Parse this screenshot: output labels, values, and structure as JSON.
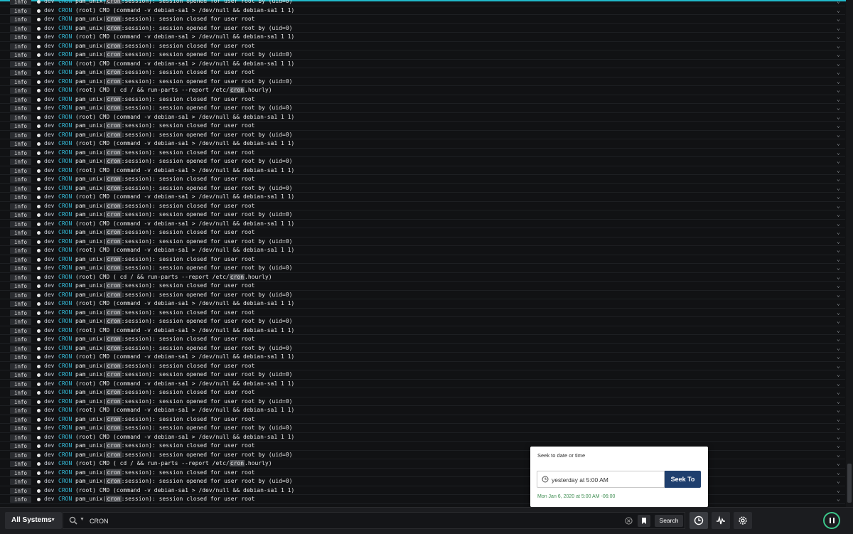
{
  "log": {
    "level": "info",
    "host": "dev",
    "program": "CRON",
    "highlight": "cron",
    "expand_icon": "chevron-down-icon",
    "rows": [
      "pam_unix(cron:session): session opened for user root by (uid=0)",
      "(root) CMD (command -v debian-sa1 > /dev/null && debian-sa1 1 1)",
      "pam_unix(cron:session): session closed for user root",
      "pam_unix(cron:session): session opened for user root by (uid=0)",
      "(root) CMD (command -v debian-sa1 > /dev/null && debian-sa1 1 1)",
      "pam_unix(cron:session): session closed for user root",
      "pam_unix(cron:session): session opened for user root by (uid=0)",
      "(root) CMD (command -v debian-sa1 > /dev/null && debian-sa1 1 1)",
      "pam_unix(cron:session): session closed for user root",
      "pam_unix(cron:session): session opened for user root by (uid=0)",
      "(root) CMD ( cd / && run-parts --report /etc/cron.hourly)",
      "pam_unix(cron:session): session closed for user root",
      "pam_unix(cron:session): session opened for user root by (uid=0)",
      "(root) CMD (command -v debian-sa1 > /dev/null && debian-sa1 1 1)",
      "pam_unix(cron:session): session closed for user root",
      "pam_unix(cron:session): session opened for user root by (uid=0)",
      "(root) CMD (command -v debian-sa1 > /dev/null && debian-sa1 1 1)",
      "pam_unix(cron:session): session closed for user root",
      "pam_unix(cron:session): session opened for user root by (uid=0)",
      "(root) CMD (command -v debian-sa1 > /dev/null && debian-sa1 1 1)",
      "pam_unix(cron:session): session closed for user root",
      "pam_unix(cron:session): session opened for user root by (uid=0)",
      "(root) CMD (command -v debian-sa1 > /dev/null && debian-sa1 1 1)",
      "pam_unix(cron:session): session closed for user root",
      "pam_unix(cron:session): session opened for user root by (uid=0)",
      "(root) CMD (command -v debian-sa1 > /dev/null && debian-sa1 1 1)",
      "pam_unix(cron:session): session closed for user root",
      "pam_unix(cron:session): session opened for user root by (uid=0)",
      "(root) CMD (command -v debian-sa1 > /dev/null && debian-sa1 1 1)",
      "pam_unix(cron:session): session closed for user root",
      "pam_unix(cron:session): session opened for user root by (uid=0)",
      "(root) CMD ( cd / && run-parts --report /etc/cron.hourly)",
      "pam_unix(cron:session): session closed for user root",
      "pam_unix(cron:session): session opened for user root by (uid=0)",
      "(root) CMD (command -v debian-sa1 > /dev/null && debian-sa1 1 1)",
      "pam_unix(cron:session): session closed for user root",
      "pam_unix(cron:session): session opened for user root by (uid=0)",
      "(root) CMD (command -v debian-sa1 > /dev/null && debian-sa1 1 1)",
      "pam_unix(cron:session): session closed for user root",
      "pam_unix(cron:session): session opened for user root by (uid=0)",
      "(root) CMD (command -v debian-sa1 > /dev/null && debian-sa1 1 1)",
      "pam_unix(cron:session): session closed for user root",
      "pam_unix(cron:session): session opened for user root by (uid=0)",
      "(root) CMD (command -v debian-sa1 > /dev/null && debian-sa1 1 1)",
      "pam_unix(cron:session): session closed for user root",
      "pam_unix(cron:session): session opened for user root by (uid=0)",
      "(root) CMD (command -v debian-sa1 > /dev/null && debian-sa1 1 1)",
      "pam_unix(cron:session): session closed for user root",
      "pam_unix(cron:session): session opened for user root by (uid=0)",
      "(root) CMD (command -v debian-sa1 > /dev/null && debian-sa1 1 1)",
      "pam_unix(cron:session): session closed for user root",
      "pam_unix(cron:session): session opened for user root by (uid=0)",
      "(root) CMD ( cd / && run-parts --report /etc/cron.hourly)",
      "pam_unix(cron:session): session closed for user root",
      "pam_unix(cron:session): session opened for user root by (uid=0)",
      "(root) CMD (command -v debian-sa1 > /dev/null && debian-sa1 1 1)",
      "pam_unix(cron:session): session closed for user root"
    ]
  },
  "toolbar": {
    "systems_label": "All Systems",
    "search_value": "CRON",
    "search_button": "Search"
  },
  "seek": {
    "title": "Seek to date or time",
    "input_value": "yesterday at 5:00 AM",
    "button": "Seek To",
    "resolved": "Mon Jan 6, 2020 at 5:00 AM -06:00"
  },
  "colors": {
    "accent": "#21b8c9",
    "program": "#35b9d6",
    "seek_button": "#1f3f6e",
    "resolved_text": "#3f8e52",
    "live": "#3cc78a"
  }
}
